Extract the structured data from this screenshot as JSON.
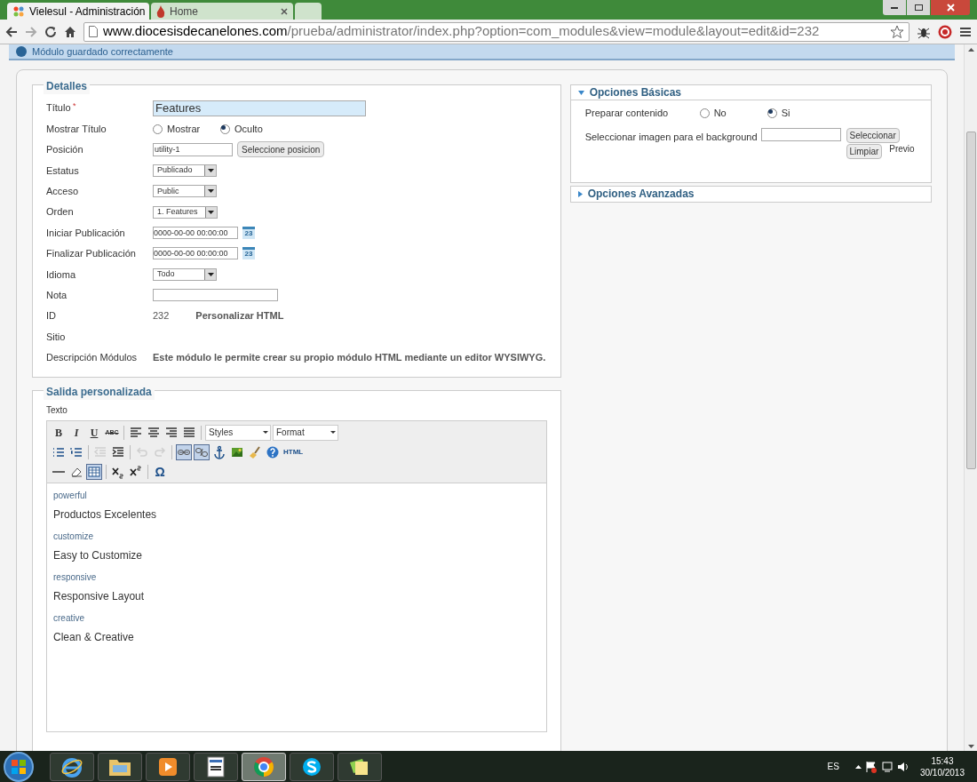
{
  "browser": {
    "tabs": [
      {
        "title": "Vielesul - Administración",
        "selected": true,
        "kind": "site"
      },
      {
        "title": "Home",
        "selected": false,
        "kind": "flame"
      },
      {
        "selected": false,
        "kind": "new"
      }
    ],
    "url": {
      "host": "www.diocesisdecanelones.com",
      "path": "/prueba/administrator/index.php?option=com_modules&view=module&layout=edit&id=232"
    }
  },
  "notice": "Módulo guardado correctamente",
  "details": {
    "legend": "Detalles",
    "fields": [
      {
        "label": "Título",
        "required": "*",
        "kind": "text",
        "value": "Features",
        "focused": true
      },
      {
        "label": "Mostrar Título",
        "kind": "radio",
        "options": [
          {
            "label": "Mostrar",
            "selected": false
          },
          {
            "label": "Oculto",
            "selected": true
          }
        ]
      },
      {
        "label": "Posición",
        "kind": "text_button",
        "value": "utility-1",
        "button": "Seleccione posicion"
      },
      {
        "label": "Estatus",
        "kind": "select",
        "value": "Publicado"
      },
      {
        "label": "Acceso",
        "kind": "select",
        "value": "Public"
      },
      {
        "label": "Orden",
        "kind": "select",
        "value": "1. Features"
      },
      {
        "label": "Iniciar Publicación",
        "kind": "date",
        "value": "0000-00-00 00:00:00",
        "calendar": "23"
      },
      {
        "label": "Finalizar Publicación",
        "kind": "date",
        "value": "0000-00-00 00:00:00",
        "calendar": "23"
      },
      {
        "label": "Idioma",
        "kind": "select",
        "value": "Todo"
      },
      {
        "label": "Nota",
        "kind": "input"
      },
      {
        "label": "ID",
        "kind": "static",
        "values": [
          "232",
          "Personalizar HTML"
        ]
      },
      {
        "label": "Sitio",
        "kind": "static"
      },
      {
        "label": "Descripción Módulos",
        "kind": "static",
        "values": [
          "Este módulo le permite crear su propio módulo HTML mediante un editor WYSIWYG."
        ]
      }
    ]
  },
  "options": [
    {
      "title": "Opciones Básicas",
      "expanded": true,
      "rows": [
        {
          "kind": "radio",
          "label": "Preparar contenido",
          "options": [
            {
              "label": "No",
              "selected": false
            },
            {
              "label": "Si",
              "selected": true
            }
          ]
        },
        {
          "kind": "image",
          "label": "Seleccionar imagen para el background",
          "buttons": [
            "Seleccionar",
            "Limpiar"
          ],
          "note": "Previo"
        }
      ]
    },
    {
      "title": "Opciones Avanzadas",
      "expanded": false
    }
  ],
  "editor": {
    "legend": "Salida personalizada",
    "label": "Texto",
    "toolbar": [
      [
        {
          "kind": "bold",
          "text": "B"
        },
        {
          "kind": "italic",
          "text": "I"
        },
        {
          "kind": "underline",
          "text": "U"
        },
        {
          "kind": "strike",
          "text": "ABC"
        },
        {
          "kind": "sep"
        },
        {
          "kind": "align-left"
        },
        {
          "kind": "align-center"
        },
        {
          "kind": "align-right"
        },
        {
          "kind": "align-justify"
        },
        {
          "kind": "sep"
        },
        {
          "kind": "dropdown",
          "text": "Styles"
        },
        {
          "kind": "dropdown",
          "text": "Format"
        }
      ],
      [
        {
          "kind": "bullets"
        },
        {
          "kind": "numbers"
        },
        {
          "kind": "sep"
        },
        {
          "kind": "outdent",
          "disabled": true
        },
        {
          "kind": "indent"
        },
        {
          "kind": "sep"
        },
        {
          "kind": "undo",
          "disabled": true
        },
        {
          "kind": "redo",
          "disabled": true
        },
        {
          "kind": "sep"
        },
        {
          "kind": "link",
          "active": true
        },
        {
          "kind": "unlink",
          "active": true
        },
        {
          "kind": "anchor"
        },
        {
          "kind": "image"
        },
        {
          "kind": "cleanup"
        },
        {
          "kind": "help"
        },
        {
          "kind": "html",
          "text": "HTML"
        }
      ],
      [
        {
          "kind": "rule"
        },
        {
          "kind": "eraser"
        },
        {
          "kind": "table",
          "active": true
        },
        {
          "kind": "sep"
        },
        {
          "kind": "subscript"
        },
        {
          "kind": "superscript"
        },
        {
          "kind": "sep"
        },
        {
          "kind": "omega",
          "text": "Ω"
        }
      ]
    ],
    "content": [
      {
        "kind": "tag",
        "text": "powerful"
      },
      {
        "kind": "heading",
        "text": "Productos Excelentes"
      },
      {
        "kind": "tag",
        "text": "customize"
      },
      {
        "kind": "heading",
        "text": "Easy to Customize"
      },
      {
        "kind": "tag",
        "text": "responsive"
      },
      {
        "kind": "heading",
        "text": "Responsive Layout"
      },
      {
        "kind": "tag",
        "text": "creative"
      },
      {
        "kind": "heading",
        "text": "Clean & Creative"
      }
    ]
  },
  "taskbar": {
    "apps": [
      {
        "kind": "ie",
        "selected": false
      },
      {
        "kind": "folder",
        "selected": false
      },
      {
        "kind": "media",
        "selected": false
      },
      {
        "kind": "document",
        "selected": false
      },
      {
        "kind": "chrome",
        "selected": true
      },
      {
        "kind": "skype",
        "selected": false
      },
      {
        "kind": "notes",
        "selected": false
      }
    ],
    "language": "ES",
    "time": "15:43",
    "date": "30/10/2013"
  }
}
